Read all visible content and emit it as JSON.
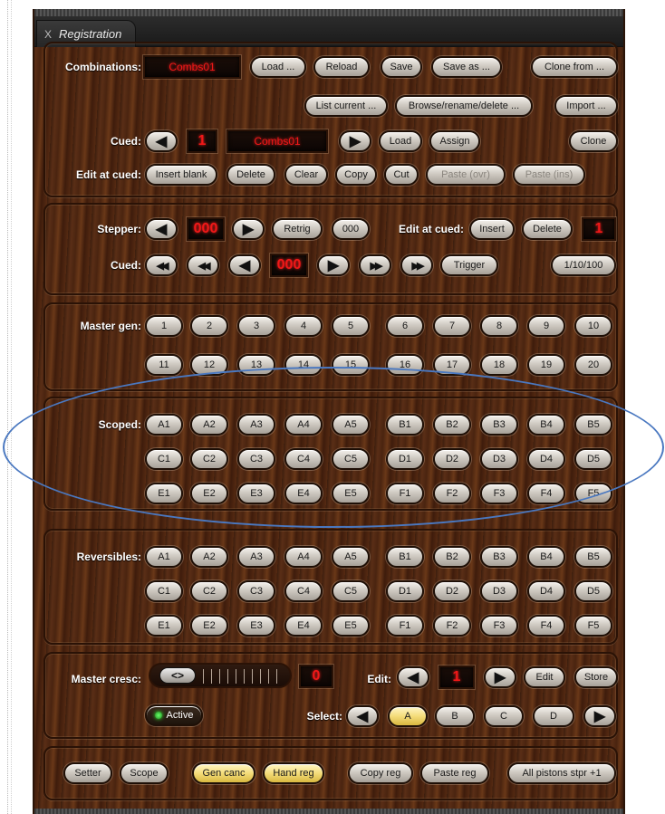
{
  "window": {
    "close_glyph": "X",
    "tab_title": "Registration"
  },
  "combos": {
    "label": "Combinations:",
    "name": "Combs01",
    "buttons": [
      "Load ...",
      "Reload",
      "Save",
      "Save as ...",
      "Clone from ..."
    ],
    "row2": [
      "List current ...",
      "Browse/rename/delete ...",
      "Import ..."
    ],
    "cued_label": "Cued:",
    "cued_num": "1",
    "cued_name": "Combs01",
    "cued_buttons": [
      "Load",
      "Assign",
      "Clone"
    ],
    "edit_label": "Edit at cued:",
    "edit_buttons": [
      "Insert blank",
      "Delete",
      "Clear",
      "Copy",
      "Cut",
      "Paste (ovr)",
      "Paste (ins)"
    ]
  },
  "stepper": {
    "label": "Stepper:",
    "value": "000",
    "retrig": "Retrig",
    "zero": "000",
    "edit_label": "Edit at cued:",
    "insert": "Insert",
    "delete": "Delete",
    "edit_num": "1",
    "cued_label": "Cued:",
    "cued_value": "000",
    "trigger": "Trigger",
    "step": "1/10/100"
  },
  "master": {
    "label": "Master gen:",
    "row1": [
      "1",
      "2",
      "3",
      "4",
      "5",
      "6",
      "7",
      "8",
      "9",
      "10"
    ],
    "row2": [
      "11",
      "12",
      "13",
      "14",
      "15",
      "16",
      "17",
      "18",
      "19",
      "20"
    ]
  },
  "scoped": {
    "label": "Scoped:",
    "rows": [
      [
        "A1",
        "A2",
        "A3",
        "A4",
        "A5",
        "B1",
        "B2",
        "B3",
        "B4",
        "B5"
      ],
      [
        "C1",
        "C2",
        "C3",
        "C4",
        "C5",
        "D1",
        "D2",
        "D3",
        "D4",
        "D5"
      ],
      [
        "E1",
        "E2",
        "E3",
        "E4",
        "E5",
        "F1",
        "F2",
        "F3",
        "F4",
        "F5"
      ]
    ]
  },
  "reversibles": {
    "label": "Reversibles:",
    "rows": [
      [
        "A1",
        "A2",
        "A3",
        "A4",
        "A5",
        "B1",
        "B2",
        "B3",
        "B4",
        "B5"
      ],
      [
        "C1",
        "C2",
        "C3",
        "C4",
        "C5",
        "D1",
        "D2",
        "D3",
        "D4",
        "D5"
      ],
      [
        "E1",
        "E2",
        "E3",
        "E4",
        "E5",
        "F1",
        "F2",
        "F3",
        "F4",
        "F5"
      ]
    ]
  },
  "cresc": {
    "label": "Master cresc:",
    "value": "0",
    "edit_label": "Edit:",
    "edit_num": "1",
    "edit": "Edit",
    "store": "Store",
    "active": "Active",
    "select_label": "Select:",
    "select": [
      "A",
      "B",
      "C",
      "D"
    ],
    "selected": "A",
    "knob": "<>"
  },
  "bottom": [
    "Setter",
    "Scope",
    "Gen canc",
    "Hand reg",
    "Copy reg",
    "Paste reg",
    "All pistons stpr +1"
  ],
  "colors": {
    "wood": "#4a2410",
    "lcd_text": "#f01818",
    "highlight": "#f4dc7a",
    "oval": "#4a78c0"
  },
  "icons": {
    "prev": "◀",
    "next": "▶",
    "rew": "◀◀",
    "ff": "▶▶"
  }
}
